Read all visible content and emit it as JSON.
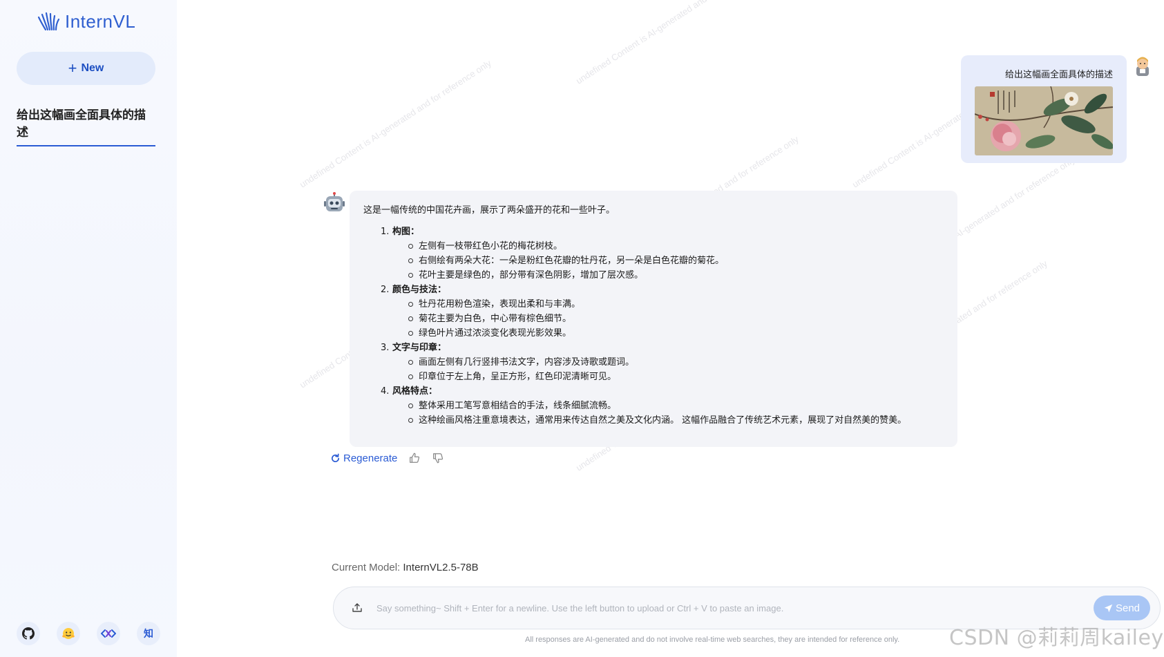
{
  "app": {
    "logo_text": "InternVL",
    "brand_color": "#2a5bd4"
  },
  "sidebar": {
    "new_label": "New",
    "conversation_title": "给出这幅画全面具体的描述",
    "footer_icons": [
      "github-icon",
      "huggingface-icon",
      "openxlab-icon",
      "zhihu-icon"
    ],
    "zhihu_label": "知"
  },
  "watermark_text": "undefined Content is AI-generated and for reference only",
  "user_message": {
    "text": "给出这幅画全面具体的描述",
    "image": "chinese-flower-painting"
  },
  "bot_message": {
    "intro": "这是一幅传统的中国花卉画，展示了两朵盛开的花和一些叶子。",
    "sections": [
      {
        "num": "1.",
        "title": "构图",
        "items": [
          "左侧有一枝带红色小花的梅花树枝。",
          "右侧绘有两朵大花：一朵是粉红色花瓣的牡丹花，另一朵是白色花瓣的菊花。",
          "花叶主要是绿色的，部分带有深色阴影，增加了层次感。"
        ]
      },
      {
        "num": "2.",
        "title": "颜色与技法",
        "items": [
          "牡丹花用粉色渲染，表现出柔和与丰满。",
          "菊花主要为白色，中心带有棕色细节。",
          "绿色叶片通过浓淡变化表现光影效果。"
        ]
      },
      {
        "num": "3.",
        "title": "文字与印章",
        "items": [
          "画面左侧有几行竖排书法文字，内容涉及诗歌或题词。",
          "印章位于左上角，呈正方形，红色印泥清晰可见。"
        ]
      },
      {
        "num": "4.",
        "title": "风格特点",
        "items": [
          "整体采用工笔写意相结合的手法，线条细腻流畅。",
          "这种绘画风格注重意境表达，通常用来传达自然之美及文化内涵。 这幅作品融合了传统艺术元素，展现了对自然美的赞美。"
        ]
      }
    ]
  },
  "actions": {
    "regenerate_label": "Regenerate"
  },
  "model": {
    "label": "Current Model:",
    "name": "InternVL2.5-78B"
  },
  "input": {
    "placeholder": "Say something~ Shift + Enter for a newline. Use the left button to upload or Ctrl + V to paste an image.",
    "value": "",
    "send_label": "Send"
  },
  "disclaimer": "All responses are AI-generated and do not involve real-time web searches, they are intended for reference only.",
  "csdn_watermark": "CSDN @莉莉周kailey"
}
